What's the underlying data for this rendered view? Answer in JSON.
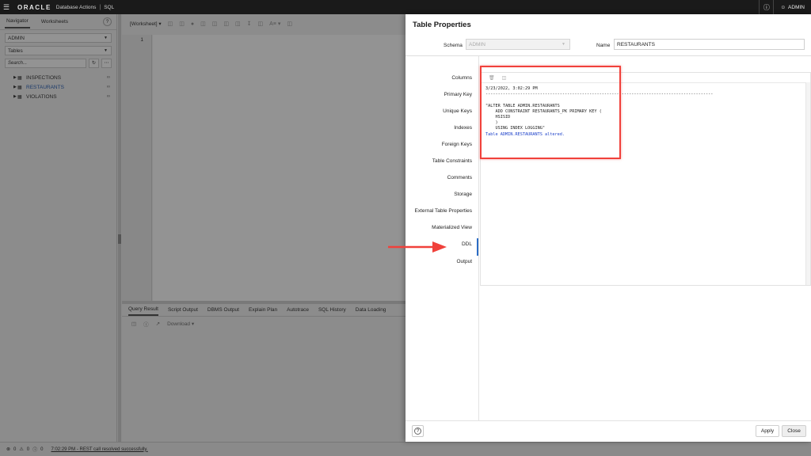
{
  "topbar": {
    "logo": "ORACLE",
    "product": "Database Actions",
    "separator": "|",
    "section": "SQL",
    "user": "ADMIN"
  },
  "navigator": {
    "tabs": [
      "Navigator",
      "Worksheets"
    ],
    "schema": "ADMIN",
    "object_type": "Tables",
    "search_placeholder": "Search...",
    "tables": [
      "INSPECTIONS",
      "RESTAURANTS",
      "VIOLATIONS"
    ],
    "selected_table": "RESTAURANTS"
  },
  "worksheet": {
    "tab_label": "[Worksheet]",
    "line_number": "1"
  },
  "bottom_panel": {
    "tabs": [
      "Query Result",
      "Script Output",
      "DBMS Output",
      "Explain Plan",
      "Autotrace",
      "SQL History",
      "Data Loading"
    ],
    "download_label": "Download"
  },
  "statusbar": {
    "errors": "0",
    "warnings": "0",
    "info": "0",
    "message": "7:02:29 PM - REST call resolved successfully."
  },
  "dialog": {
    "title": "Table Properties",
    "schema_label": "Schema",
    "schema_value": "ADMIN",
    "name_label": "Name",
    "name_value": "RESTAURANTS",
    "nav_items": [
      "Columns",
      "Primary Key",
      "Unique Keys",
      "Indexes",
      "Foreign Keys",
      "Table Constraints",
      "Comments",
      "Storage",
      "External Table Properties",
      "Materialized View",
      "DDL",
      "Output"
    ],
    "active_nav": "Output",
    "output": {
      "timestamp": "3/23/2022, 3:02:29 PM",
      "divider": "--------------------------------------------------------------------------------------------",
      "sql_lines": [
        "\"ALTER TABLE ADMIN.RESTAURANTS",
        "    ADD CONSTRAINT RESTAURANTS_PK PRIMARY KEY (",
        "    HSISID",
        "    )",
        "    USING INDEX LOGGING\""
      ],
      "result": "Table ADMIN.RESTAURANTS altered."
    },
    "apply_label": "Apply",
    "close_label": "Close"
  },
  "colors": {
    "highlight_box": "#f0413b",
    "active_nav_bar": "#2b6cc4",
    "result_text": "#1a3fc9"
  }
}
